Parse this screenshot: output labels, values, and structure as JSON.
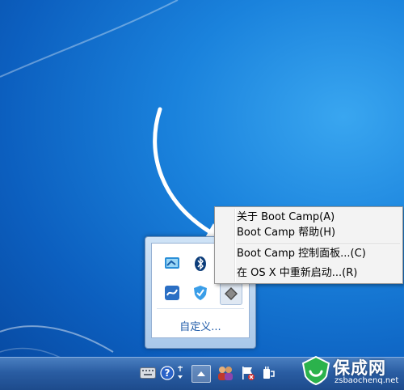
{
  "tray": {
    "customize_label": "自定义...",
    "icons": [
      "display-settings-icon",
      "bluetooth-icon",
      "network-tool-icon",
      "security-shield-icon",
      "boot-camp-icon"
    ]
  },
  "context_menu": {
    "items": [
      "关于 Boot Camp(A)",
      "Boot Camp 帮助(H)",
      "Boot Camp 控制面板...(C)",
      "在 OS X 中重新启动...(R)"
    ]
  },
  "taskbar": {
    "icons": [
      "keyboard-icon",
      "help-icon",
      "network-status-icon",
      "show-hidden-icons-icon",
      "users-icon",
      "action-center-flag-icon",
      "power-icon"
    ]
  },
  "watermark": {
    "title": "保成网",
    "url": "zsbaochenq.net"
  },
  "colors": {
    "desktop_blue": "#1a82dc",
    "menu_bg": "#f3f3f3",
    "link_blue": "#1e5aa8",
    "watermark_green": "#2bb24c"
  }
}
